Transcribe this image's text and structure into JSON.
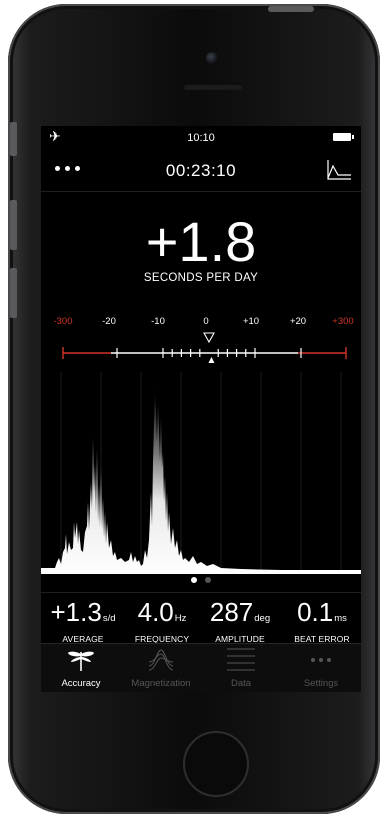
{
  "status_bar": {
    "time": "10:10",
    "airplane_icon": "airplane-icon",
    "battery_icon": "battery-icon"
  },
  "nav": {
    "menu_icon": "more-dots-icon",
    "elapsed": "00:23:10",
    "graph_icon": "graph-icon"
  },
  "main": {
    "rate_value": "+1.8",
    "rate_label": "SECONDS PER DAY"
  },
  "scale": {
    "labels": [
      "-300",
      "-20",
      "-10",
      "0",
      "+10",
      "+20",
      "+300"
    ],
    "marker_value": 1.8,
    "colors": {
      "limit": "#d2332a",
      "normal": "#ffffff"
    }
  },
  "pager": {
    "pages": 2,
    "current": 1
  },
  "stats": [
    {
      "value": "+1.3",
      "unit": "s/d",
      "label": "AVERAGE"
    },
    {
      "value": "4.0",
      "unit": "Hz",
      "label": "FREQUENCY"
    },
    {
      "value": "287",
      "unit": "deg",
      "label": "AMPLITUDE"
    },
    {
      "value": "0.1",
      "unit": "ms",
      "label": "BEAT ERROR"
    }
  ],
  "tabs": [
    {
      "label": "Accuracy",
      "icon": "dragonfly-icon",
      "active": true
    },
    {
      "label": "Magnetization",
      "icon": "magnet-wave-icon",
      "active": false
    },
    {
      "label": "Data",
      "icon": "list-lines-icon",
      "active": false
    },
    {
      "label": "Settings",
      "icon": "more-dots-icon",
      "active": false
    }
  ]
}
